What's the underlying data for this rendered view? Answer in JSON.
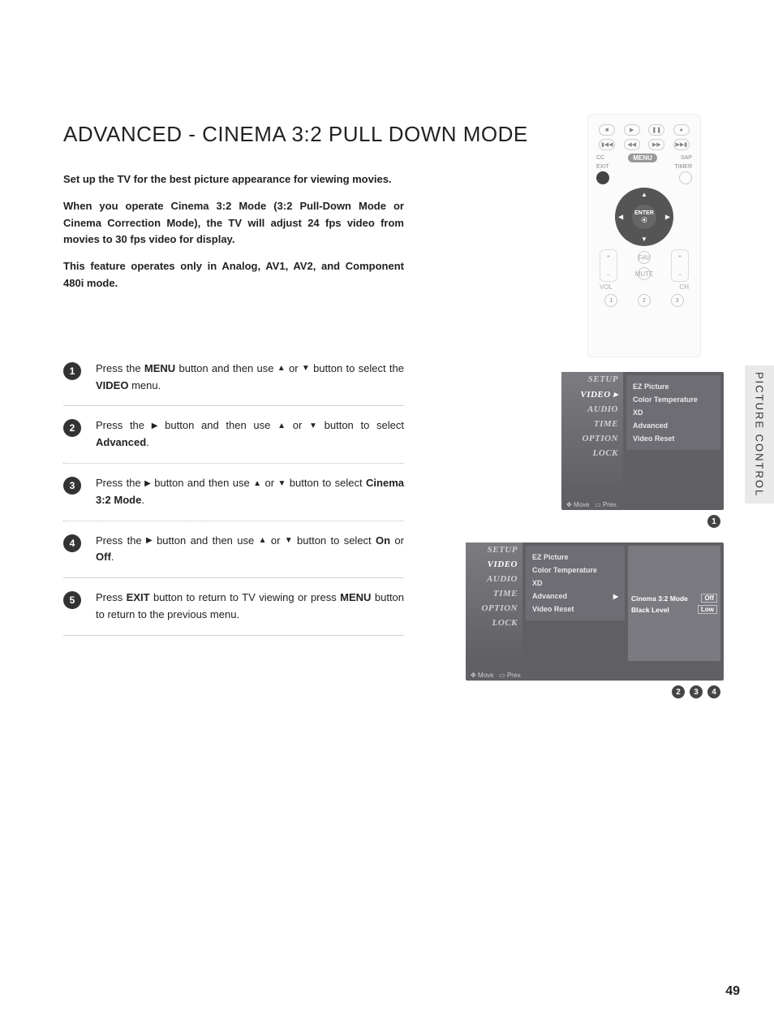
{
  "title": "ADVANCED - CINEMA 3:2 PULL DOWN MODE",
  "intro": {
    "p1": "Set up the TV for the best picture appearance for viewing movies.",
    "p2": "When you operate Cinema 3:2 Mode (3:2 Pull-Down Mode or Cinema Correction Mode), the TV will adjust 24 fps video from movies to 30 fps video for display.",
    "p3": "This feature operates only in Analog, AV1, AV2, and Component 480i mode."
  },
  "steps": [
    {
      "n": "1",
      "parts": [
        "Press the ",
        "MENU",
        " button and then use ",
        "▲",
        " or ",
        "▼",
        " button to select the ",
        "VIDEO",
        " menu."
      ]
    },
    {
      "n": "2",
      "parts": [
        "Press the ",
        "▶",
        " button and then use ",
        "▲",
        " or ",
        "▼",
        " button to select ",
        "Advanced",
        "."
      ]
    },
    {
      "n": "3",
      "parts": [
        "Press the ",
        "▶",
        " button and then use ",
        "▲",
        " or ",
        "▼",
        " button to select ",
        "Cinema 3:2 Mode",
        "."
      ]
    },
    {
      "n": "4",
      "parts": [
        "Press the ",
        "▶",
        " button and then use ",
        "▲",
        " or ",
        "▼",
        " button to select ",
        "On",
        " or ",
        "Off",
        "."
      ]
    },
    {
      "n": "5",
      "parts": [
        "Press ",
        "EXIT",
        " button to return to TV viewing or press ",
        "MENU",
        " button to return to the previous menu."
      ]
    }
  ],
  "side_tab": "PICTURE CONTROL",
  "remote": {
    "cc": "CC",
    "sap": "SAP",
    "exit": "EXIT",
    "timer": "TIMER",
    "menu": "MENU",
    "enter": "ENTER",
    "enter_icon": "⦿",
    "vol": "VOL",
    "ch": "CH",
    "fav": "FAV",
    "mute": "MUTE",
    "nums": [
      "1",
      "2",
      "3"
    ],
    "play": "▶",
    "pause": "❚❚",
    "stop": "■",
    "rec": "●",
    "rew": "◀◀",
    "ff": "▶▶",
    "prev": "▮◀◀",
    "next": "▶▶▮",
    "plus": "+",
    "minus": "−"
  },
  "osd_menu_items": [
    "SETUP",
    "VIDEO",
    "AUDIO",
    "TIME",
    "OPTION",
    "LOCK"
  ],
  "osd_panel": {
    "ez": "EZ Picture",
    "ct": "Color Temperature",
    "xd": "XD",
    "adv": "Advanced",
    "vr": "Video Reset"
  },
  "osd_foot_move": "Move",
  "osd_foot_prev": "Prev.",
  "osd_sub": {
    "cinema_label": "Cinema 3:2 Mode",
    "cinema_val": "Off",
    "black_label": "Black Level",
    "black_val": "Low"
  },
  "osd_arrows": {
    "caret": "▸",
    "right": "▶"
  },
  "badges1": [
    "1"
  ],
  "badges2": [
    "2",
    "3",
    "4"
  ],
  "page_num": "49"
}
